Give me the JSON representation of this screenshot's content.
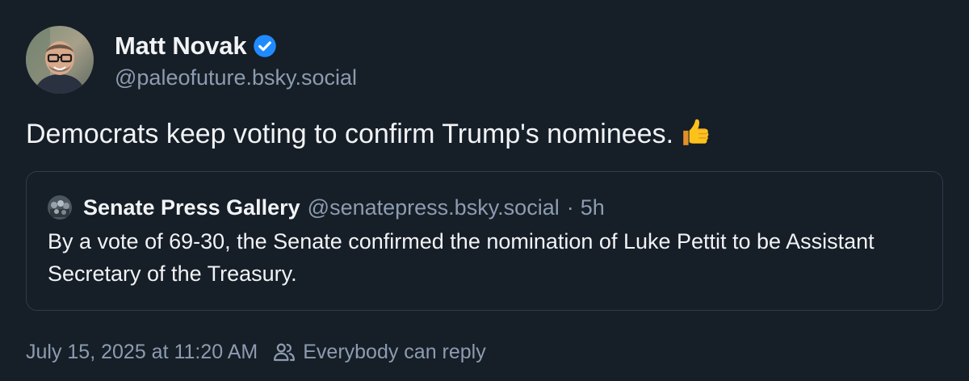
{
  "author": {
    "display_name": "Matt Novak",
    "handle": "@paleofuture.bsky.social",
    "verified_icon": "verified-check-icon",
    "avatar_icon": "avatar-photo"
  },
  "post": {
    "text": "Democrats keep voting to confirm Trump's nominees.",
    "emoji_icon": "thumbs-up-icon"
  },
  "quote": {
    "display_name": "Senate Press Gallery",
    "handle": "@senatepress.bsky.social",
    "separator": "·",
    "time": "5h",
    "text": "By a vote of 69-30, the Senate confirmed the nomination of Luke Pettit to be Assistant Secretary of the Treasury."
  },
  "footer": {
    "timestamp": "July 15, 2025 at 11:20 AM",
    "reply_setting": "Everybody can reply",
    "reply_icon": "people-icon"
  },
  "colors": {
    "background": "#161e27",
    "text": "#f1f3f5",
    "muted": "#8c9cb0",
    "border": "#2e3c4c",
    "verified": "#208bfe"
  }
}
